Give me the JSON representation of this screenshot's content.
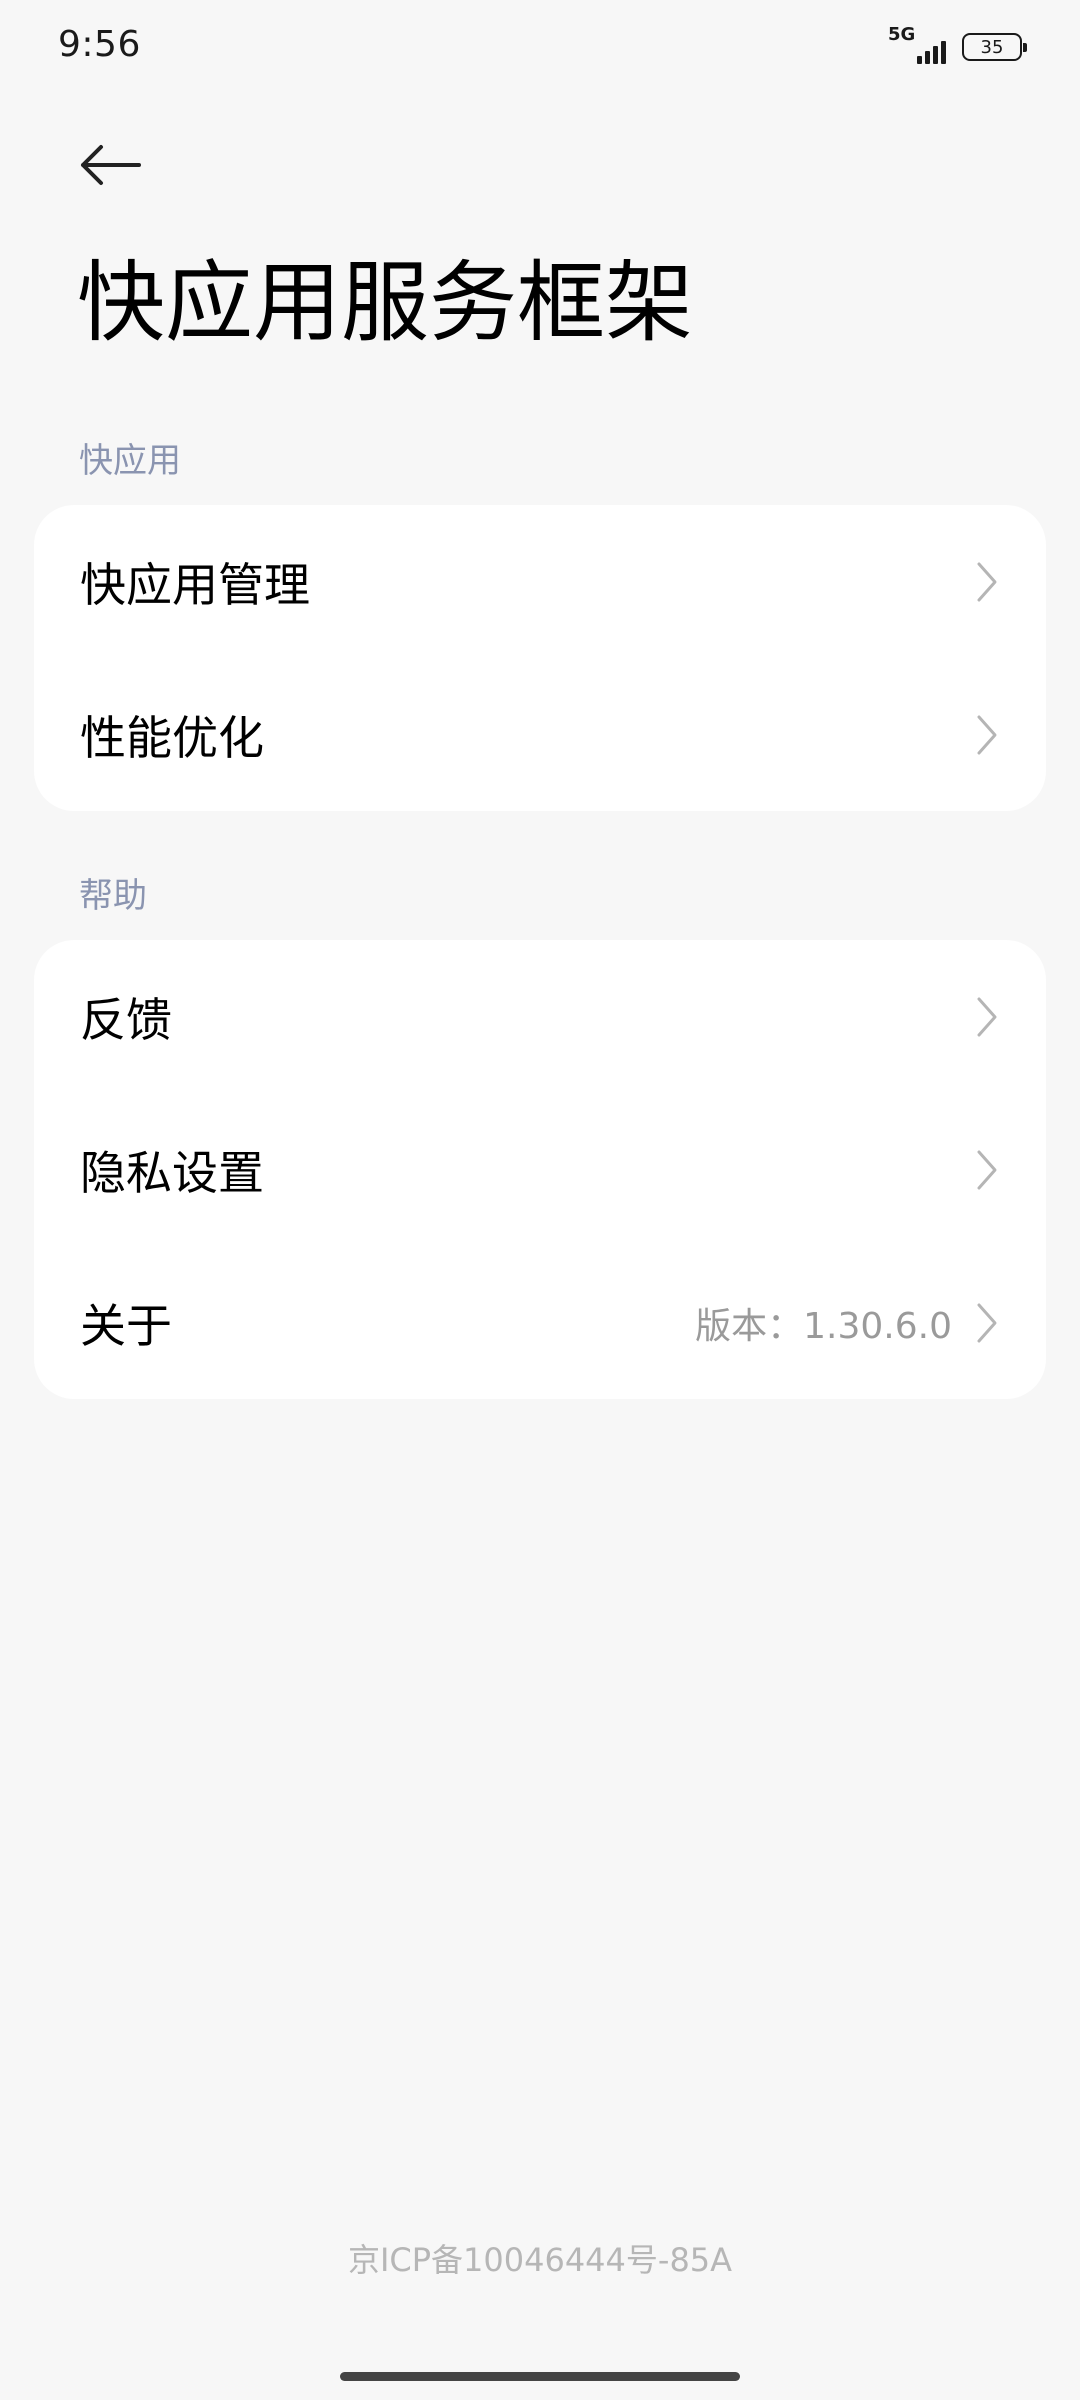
{
  "status_bar": {
    "time": "9:56",
    "network": "5G",
    "battery": "35"
  },
  "header": {
    "title": "快应用服务框架"
  },
  "sections": [
    {
      "title": "快应用",
      "items": [
        {
          "label": "快应用管理",
          "value": ""
        },
        {
          "label": "性能优化",
          "value": ""
        }
      ]
    },
    {
      "title": "帮助",
      "items": [
        {
          "label": "反馈",
          "value": ""
        },
        {
          "label": "隐私设置",
          "value": ""
        },
        {
          "label": "关于",
          "value": "版本：1.30.6.0"
        }
      ]
    }
  ],
  "footer": {
    "icp": "京ICP备10046444号-85A"
  },
  "icons": {
    "back": "back-arrow-icon",
    "chevron": "chevron-right-icon",
    "signal": "signal-icon",
    "battery": "battery-icon"
  },
  "colors": {
    "background": "#f7f7f7",
    "card": "#ffffff",
    "section_title": "#8a94b0",
    "secondary_text": "#9a9a9a",
    "footer_text": "#b6b6b6"
  }
}
